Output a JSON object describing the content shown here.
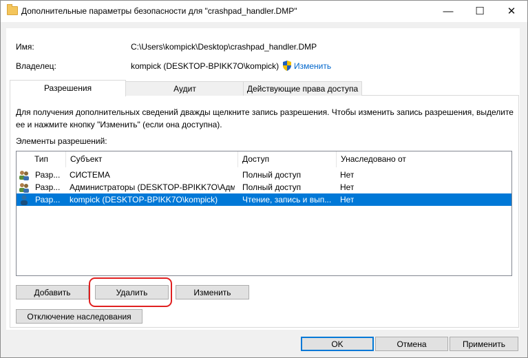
{
  "window": {
    "title": "Дополнительные параметры безопасности  для \"crashpad_handler.DMP\"",
    "minimize": "—",
    "maximize": "☐",
    "close": "✕"
  },
  "info": {
    "name_label": "Имя:",
    "name_value": "C:\\Users\\kompick\\Desktop\\crashpad_handler.DMP",
    "owner_label": "Владелец:",
    "owner_value": "kompick (DESKTOP-BPIKK7O\\kompick)",
    "owner_change_link": "Изменить"
  },
  "tabs": [
    {
      "label": "Разрешения",
      "active": true
    },
    {
      "label": "Аудит",
      "active": false
    },
    {
      "label": "Действующие права доступа",
      "active": false
    }
  ],
  "panel": {
    "description": "Для получения дополнительных сведений дважды щелкните запись разрешения. Чтобы изменить запись разрешения, выделите ее и нажмите кнопку \"Изменить\" (если она доступна).",
    "description_line1": "Для получения дополнительных сведений дважды щелкните запись разрешения. Чтобы изменить запись разрешения, выделите",
    "description_line2": "ее и нажмите кнопку \"Изменить\" (если она доступна).",
    "list_label": "Элементы разрешений:"
  },
  "table": {
    "columns": [
      "Тип",
      "Субъект",
      "Доступ",
      "Унаследовано от"
    ],
    "rows": [
      {
        "type": "Разр...",
        "subject": "СИСТЕМА",
        "access": "Полный доступ",
        "inherited": "Нет",
        "icon": "users-icon",
        "selected": false
      },
      {
        "type": "Разр...",
        "subject": "Администраторы (DESKTOP-BPIKK7O\\Адм...",
        "access": "Полный доступ",
        "inherited": "Нет",
        "icon": "users-icon",
        "selected": false
      },
      {
        "type": "Разр...",
        "subject": "kompick (DESKTOP-BPIKK7O\\kompick)",
        "access": "Чтение, запись и вып...",
        "inherited": "Нет",
        "icon": "user-icon",
        "selected": true
      }
    ]
  },
  "buttons": {
    "add": "Добавить",
    "delete": "Удалить",
    "edit": "Изменить",
    "disable_inheritance": "Отключение наследования",
    "ok": "OK",
    "cancel": "Отмена",
    "apply": "Применить"
  },
  "colors": {
    "selection": "#0078d7",
    "highlight_ring": "#e02020",
    "link": "#0066cc"
  }
}
